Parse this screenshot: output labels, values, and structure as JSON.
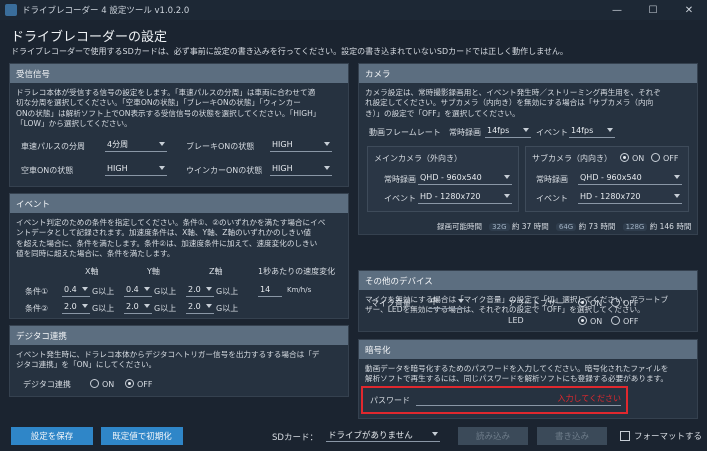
{
  "window": {
    "title": "ドライブレコーダー 4 設定ツール v1.0.2.0",
    "minimize": "—",
    "maximize": "☐",
    "close": "✕"
  },
  "page": {
    "title": "ドライブレコーダーの設定",
    "description": "ドライブレコーダーで使用するSDカードは、必ず事前に設定の書き込みを行ってください。設定の書き込まれていないSDカードでは正しく動作しません。"
  },
  "signal": {
    "title": "受信信号",
    "desc1": "ドラレコ本体が受信する信号の設定をします。「車速パルスの分周」は車両に合わせて適",
    "desc2": "切な分周を選択してください。「空車ONの状態」「ブレーキONの状態」「ウィンカー",
    "desc3": "ONの状態」は解析ソフト上でON表示する受信信号の状態を選択してください。「HIGH」",
    "desc4": "「LOW」から選択してください。",
    "pulse_label": "車速パルスの分周",
    "pulse_value": "4分周",
    "brake_label": "ブレーキONの状態",
    "brake_value": "HIGH",
    "vacant_label": "空車ONの状態",
    "vacant_value": "HIGH",
    "winker_label": "ウインカーONの状態",
    "winker_value": "HIGH"
  },
  "event": {
    "title": "イベント",
    "desc1": "イベント判定のための条件を指定してください。条件①、②のいずれかを満たす場合にイベ",
    "desc2": "ントデータとして記録されます。加速度条件は、X軸、Y軸、Z軸のいずれかのしきい値",
    "desc3": "を超えた場合に、条件を満たします。条件②は、加速度条件に加えて、速度変化のしきい",
    "desc4": "値を同時に超えた場合に、条件を満たします。",
    "col_x": "X軸",
    "col_y": "Y軸",
    "col_z": "Z軸",
    "col_speed": "1秒あたりの速度変化",
    "cond1_label": "条件①",
    "cond2_label": "条件②",
    "cond1_x": "0.4",
    "cond1_y": "0.4",
    "cond1_z": "2.0",
    "cond2_x": "2.0",
    "cond2_y": "2.0",
    "cond2_z": "2.0",
    "unit": "G以上",
    "speed_value": "14",
    "speed_unit": "Km/h/s"
  },
  "digitaco": {
    "title": "デジタコ連携",
    "desc1": "イベント発生時に、ドラレコ本体からデジタコへトリガー信号を出力するする場合は「デ",
    "desc2": "ジタコ連携」を「ON」にしてください。",
    "label": "デジタコ連携",
    "on": "ON",
    "off": "OFF"
  },
  "camera": {
    "title": "カメラ",
    "desc1": "カメラ設定は、常時撮影録画用と、イベント発生時／ストリーミング再生用を、それぞ",
    "desc2": "れ設定してください。サブカメラ（内向き）を無効にする場合は「サブカメラ（内向",
    "desc3": "き）」の設定で「OFF」を選択してください。",
    "framerate_label": "動画フレームレート",
    "always_label": "常時録画",
    "always_fps": "14fps",
    "event_label": "イベント",
    "event_fps": "14fps",
    "main_title": "メインカメラ（外向き）",
    "sub_title": "サブカメラ（内向き）",
    "main_always_label": "常時録画",
    "main_always_value": "QHD - 960x540",
    "main_event_label": "イベント",
    "main_event_value": "HD - 1280x720",
    "sub_always_label": "常時録画",
    "sub_always_value": "QHD - 960x540",
    "sub_event_label": "イベント",
    "sub_event_value": "HD - 1280x720",
    "sub_on": "ON",
    "sub_off": "OFF",
    "rec_time_label": "録画可能時間",
    "sd32": "32G",
    "sd32_time": "約 37 時間",
    "sd64": "64G",
    "sd64_time": "約 73 時間",
    "sd128": "128G",
    "sd128_time": "約 146 時間"
  },
  "devices": {
    "title": "その他のデバイス",
    "desc1": "マイクを無効にする場合は「マイク音量」の設定で「切」選択してください。アラートブ",
    "desc2": "ザー、LEDを無効にする場合は、それぞれの設定で「OFF」を選択してください。",
    "mic_label": "マイク音量",
    "mic_value": "中",
    "buzzer_label": "アラートブザー",
    "led_label": "LED",
    "on": "ON",
    "off": "OFF"
  },
  "encryption": {
    "title": "暗号化",
    "desc1": "動画データを暗号化するためのパスワードを入力してください。暗号化されたファイルを",
    "desc2": "解析ソフトで再生するには、同じパスワードを解析ソフトにも登録する必要があります。",
    "password_label": "パスワード",
    "password_placeholder": "入力してください"
  },
  "footer": {
    "save_button": "設定を保存",
    "init_button": "既定値で初期化",
    "sd_label": "SDカード：",
    "sd_value": "ドライブがありません",
    "read_button": "読み込み",
    "write_button": "書き込み",
    "format_label": "フォーマットする"
  }
}
